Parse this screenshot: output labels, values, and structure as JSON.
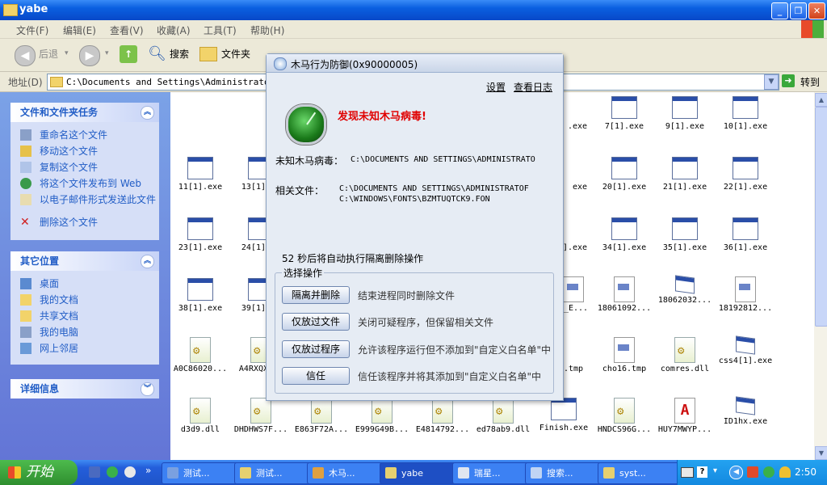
{
  "window": {
    "title": "yabe"
  },
  "menu": [
    "文件(F)",
    "编辑(E)",
    "查看(V)",
    "收藏(A)",
    "工具(T)",
    "帮助(H)"
  ],
  "toolbar": {
    "back": "后退",
    "search": "搜索",
    "folders": "文件夹"
  },
  "address": {
    "label": "地址(D)",
    "value": "C:\\Documents and Settings\\Administrator\\桌",
    "go": "转到"
  },
  "left_pane": {
    "tasks_title": "文件和文件夹任务",
    "tasks": [
      "重命名这个文件",
      "移动这个文件",
      "复制这个文件",
      "将这个文件发布到 Web",
      "以电子邮件形式发送此文件",
      "删除这个文件"
    ],
    "places_title": "其它位置",
    "places": [
      "桌面",
      "我的文档",
      "共享文档",
      "我的电脑",
      "网上邻居"
    ],
    "details_title": "详细信息"
  },
  "files": [
    {
      "name": ".exe",
      "type": "exe"
    },
    {
      "name": "7[1].exe",
      "type": "exe"
    },
    {
      "name": "9[1].exe",
      "type": "exe"
    },
    {
      "name": "10[1].exe",
      "type": "exe"
    },
    {
      "name": "11[1].exe",
      "type": "exe"
    },
    {
      "name": "13[1]...",
      "type": "exe"
    },
    {
      "name": "exe",
      "type": "exe"
    },
    {
      "name": "20[1].exe",
      "type": "exe"
    },
    {
      "name": "21[1].exe",
      "type": "exe"
    },
    {
      "name": "22[1].exe",
      "type": "exe"
    },
    {
      "name": "23[1].exe",
      "type": "exe"
    },
    {
      "name": "24[1]...",
      "type": "exe"
    },
    {
      "name": "].exe",
      "type": "exe"
    },
    {
      "name": "34[1].exe",
      "type": "exe"
    },
    {
      "name": "35[1].exe",
      "type": "exe"
    },
    {
      "name": "36[1].exe",
      "type": "exe"
    },
    {
      "name": "38[1].exe",
      "type": "exe"
    },
    {
      "name": "39[1]...",
      "type": "exe"
    },
    {
      "name": "2_E...",
      "type": "tmp"
    },
    {
      "name": "18061092...",
      "type": "tmp"
    },
    {
      "name": "18062032...",
      "type": "exe2"
    },
    {
      "name": "18192812...",
      "type": "tmp"
    },
    {
      "name": "A0C86020...",
      "type": "dll"
    },
    {
      "name": "A4RXQX...",
      "type": "dll"
    },
    {
      "name": ".tmp",
      "type": "tmp"
    },
    {
      "name": "cho16.tmp",
      "type": "tmp"
    },
    {
      "name": "comres.dll",
      "type": "dll"
    },
    {
      "name": "css4[1].exe",
      "type": "exe2"
    },
    {
      "name": "d3d9.dll",
      "type": "dll"
    },
    {
      "name": "DHDHWS7F...",
      "type": "dll"
    },
    {
      "name": "E863F72A...",
      "type": "dll"
    },
    {
      "name": "E999G49B...",
      "type": "dll"
    },
    {
      "name": "E4814792...",
      "type": "dll"
    },
    {
      "name": "ed78ab9.dll",
      "type": "dll"
    },
    {
      "name": "Finish.exe",
      "type": "exe"
    },
    {
      "name": "HNDCS96G...",
      "type": "dll"
    },
    {
      "name": "HUY7MWYP...",
      "type": "pdf"
    },
    {
      "name": "ID1hx.exe",
      "type": "exe2"
    }
  ],
  "dialog": {
    "title": "木马行为防御(0x90000005)",
    "link_settings": "设置",
    "link_log": "查看日志",
    "alert": "发现未知木马病毒!",
    "virus_label": "未知木马病毒：",
    "virus_path": "C:\\DOCUMENTS AND SETTINGS\\ADMINISTRATO",
    "related_label": "相关文件：",
    "related_path_1": "C:\\DOCUMENTS AND SETTINGS\\ADMINISTRATOF",
    "related_path_2": "C:\\WINDOWS\\FONTS\\BZMTUQTCK9.FON",
    "countdown": "52 秒后将自动执行隔离删除操作",
    "group_title": "选择操作",
    "actions": [
      {
        "button": "隔离并删除",
        "desc": "结束进程同时删除文件"
      },
      {
        "button": "仅放过文件",
        "desc": "关闭可疑程序，但保留相关文件"
      },
      {
        "button": "仅放过程序",
        "desc": "允许该程序运行但不添加到\"自定义白名单\"中"
      },
      {
        "button": "信任",
        "desc": "信任该程序并将其添加到\"自定义白名单\"中"
      }
    ]
  },
  "taskbar": {
    "start": "开始",
    "items": [
      "测试...",
      "测试...",
      "木马...",
      "yabe",
      "瑞星...",
      "搜索...",
      "syst..."
    ],
    "clock": "2:50"
  }
}
